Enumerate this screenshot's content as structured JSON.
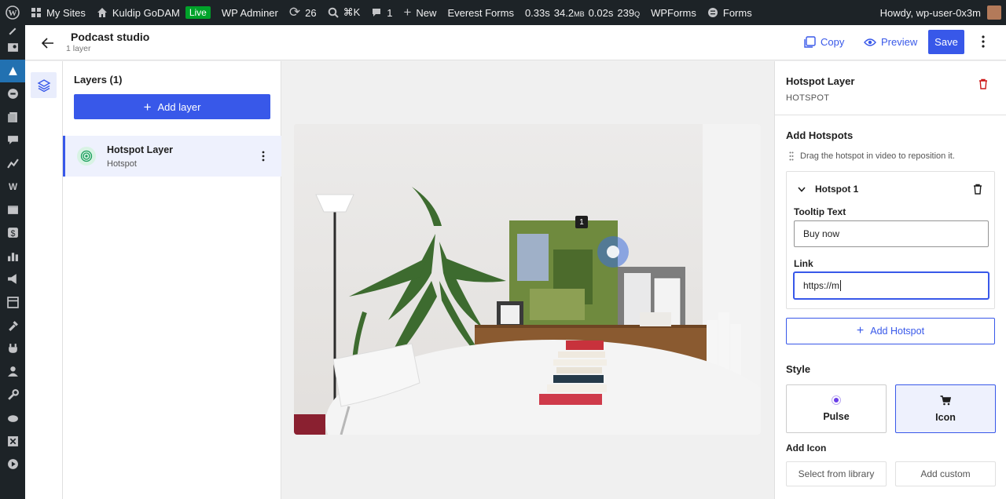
{
  "admin_bar": {
    "my_sites": "My Sites",
    "site_name": "Kuldip GoDAM",
    "live_badge": "Live",
    "wp_adminer": "WP Adminer",
    "updates_count": "26",
    "search_shortcut": "⌘K",
    "comments_count": "1",
    "new_label": "New",
    "everest_forms": "Everest Forms",
    "perf_time1": "0.33s",
    "perf_mem_value": "34.2",
    "perf_mem_unit": "MB",
    "perf_time2": "0.02s",
    "perf_queries_value": "239",
    "perf_queries_unit": "Q",
    "wpforms": "WPForms",
    "forms": "Forms",
    "howdy": "Howdy, wp-user-0x3m"
  },
  "header": {
    "title": "Podcast studio",
    "subtitle": "1 layer",
    "copy_label": "Copy",
    "preview_label": "Preview",
    "save_label": "Save"
  },
  "layers_panel": {
    "title": "Layers (1)",
    "add_layer_label": "Add layer",
    "items": [
      {
        "name": "Hotspot Layer",
        "type": "Hotspot"
      }
    ]
  },
  "canvas": {
    "hotspot_number": "1"
  },
  "settings": {
    "title": "Hotspot Layer",
    "subtitle": "HOTSPOT",
    "add_hotspots_title": "Add Hotspots",
    "drag_hint": "Drag the hotspot in video to reposition it.",
    "hotspot": {
      "label": "Hotspot 1",
      "tooltip_label": "Tooltip Text",
      "tooltip_value": "Buy now",
      "link_label": "Link",
      "link_value": "https://m"
    },
    "add_hotspot_label": "Add Hotspot",
    "style_title": "Style",
    "style_options": [
      "Pulse",
      "Icon"
    ],
    "selected_style": "Icon",
    "add_icon_title": "Add Icon",
    "select_library_label": "Select from library",
    "add_custom_label": "Add custom"
  },
  "colors": {
    "accent": "#3858e9",
    "admin_bar_bg": "#1d2327",
    "live_green": "#00a32a",
    "danger": "#cc1818"
  }
}
